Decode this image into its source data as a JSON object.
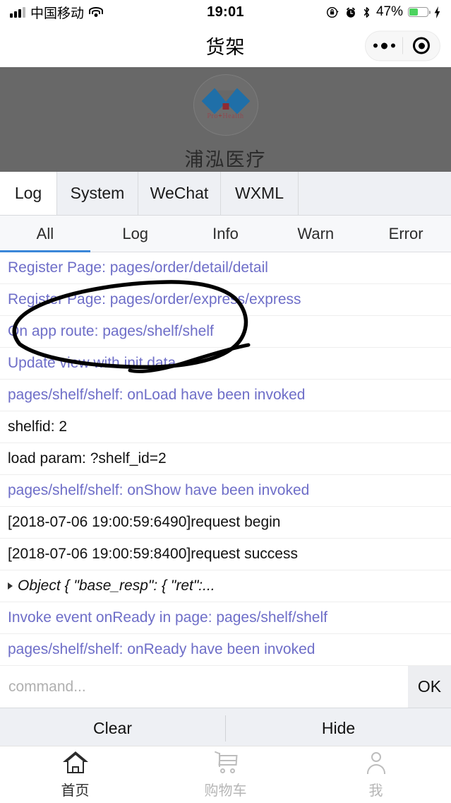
{
  "statusbar": {
    "carrier": "中国移动",
    "time": "19:01",
    "battery_percent": "47%",
    "icons": [
      "signal-icon",
      "wifi-icon",
      "rotation-lock-icon",
      "alarm-icon",
      "bluetooth-icon",
      "battery-icon",
      "charging-bolt-icon"
    ]
  },
  "navbar": {
    "title": "货架",
    "menu_icon": "more-dots-icon",
    "target_icon": "capsule-target-icon"
  },
  "page": {
    "brand_cn": "浦泓医疗",
    "logo_text_pre": "Pro",
    "logo_text_plus": "+",
    "logo_text_post": "Health",
    "background_color": "#686868"
  },
  "debugger": {
    "tabs": [
      {
        "label": "Log",
        "active": true
      },
      {
        "label": "System",
        "active": false
      },
      {
        "label": "WeChat",
        "active": false
      },
      {
        "label": "WXML",
        "active": false
      }
    ],
    "filters": [
      {
        "label": "All",
        "active": true
      },
      {
        "label": "Log",
        "active": false
      },
      {
        "label": "Info",
        "active": false
      },
      {
        "label": "Warn",
        "active": false
      },
      {
        "label": "Error",
        "active": false
      }
    ],
    "accent_color": "#3a87d8",
    "system_log_color": "#6e6ec8",
    "logs": [
      {
        "text": "Register Page: pages/order/detail/detail",
        "kind": "sys"
      },
      {
        "text": "Register Page: pages/order/express/express",
        "kind": "sys"
      },
      {
        "text": "On app route: pages/shelf/shelf",
        "kind": "sys"
      },
      {
        "text": "Update view with init data",
        "kind": "sys"
      },
      {
        "text": "pages/shelf/shelf: onLoad have been invoked",
        "kind": "sys"
      },
      {
        "text": "shelfid: 2",
        "kind": "usr"
      },
      {
        "text": "load param: ?shelf_id=2",
        "kind": "usr"
      },
      {
        "text": "pages/shelf/shelf: onShow have been invoked",
        "kind": "sys"
      },
      {
        "text": "[2018-07-06 19:00:59:6490]request begin",
        "kind": "usr"
      },
      {
        "text": "[2018-07-06 19:00:59:8400]request success",
        "kind": "usr"
      },
      {
        "text": "Object { \"base_resp\": { \"ret\":...",
        "kind": "obj"
      },
      {
        "text": "Invoke event onReady in page: pages/shelf/shelf",
        "kind": "sys"
      },
      {
        "text": "pages/shelf/shelf: onReady have been invoked",
        "kind": "sys"
      }
    ],
    "command": {
      "value": "",
      "placeholder": "command...",
      "ok_label": "OK"
    },
    "actions": [
      {
        "label": "Clear"
      },
      {
        "label": "Hide"
      }
    ]
  },
  "annotation": {
    "type": "hand-drawn-ellipse",
    "color": "#000000",
    "target_log": "On app route: pages/shelf/shelf"
  },
  "tabbar": [
    {
      "label": "首页",
      "icon": "home-icon",
      "active": true
    },
    {
      "label": "购物车",
      "icon": "cart-icon",
      "active": false
    },
    {
      "label": "我",
      "icon": "person-icon",
      "active": false
    }
  ]
}
